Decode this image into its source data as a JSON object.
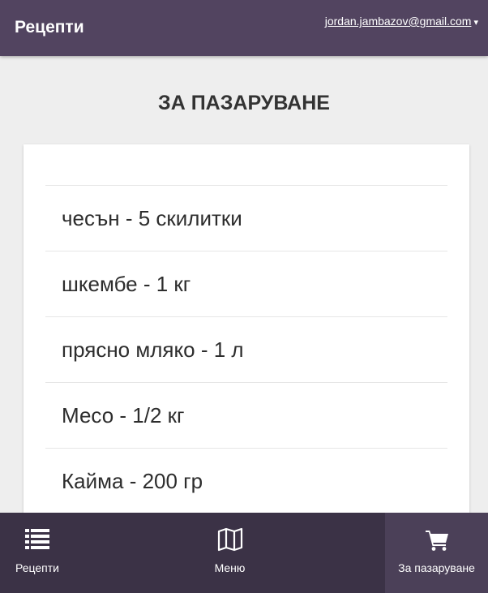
{
  "header": {
    "brand": "Рецепти",
    "user_email": "jordan.jambazov@gmail.com",
    "caret": "▾"
  },
  "page": {
    "title": "ЗА ПАЗАРУВАНЕ"
  },
  "shopping_list": {
    "items": [
      {
        "label": "чесън - 5 скилитки"
      },
      {
        "label": "шкембе - 1 кг"
      },
      {
        "label": "прясно мляко - 1 л"
      },
      {
        "label": "Месо - 1/2 кг"
      },
      {
        "label": "Кайма - 200 гр"
      }
    ]
  },
  "bottom_nav": {
    "items": [
      {
        "label": "Рецепти",
        "icon": "list-icon"
      },
      {
        "label": "Меню",
        "icon": "map-icon"
      },
      {
        "label": "За пазаруване",
        "icon": "shopping-cart-icon",
        "active": true
      }
    ]
  },
  "colors": {
    "header_bg": "#524460",
    "nav_bg": "#3b3246",
    "nav_active_bg": "#4b4058",
    "page_bg": "#eeeeee"
  }
}
